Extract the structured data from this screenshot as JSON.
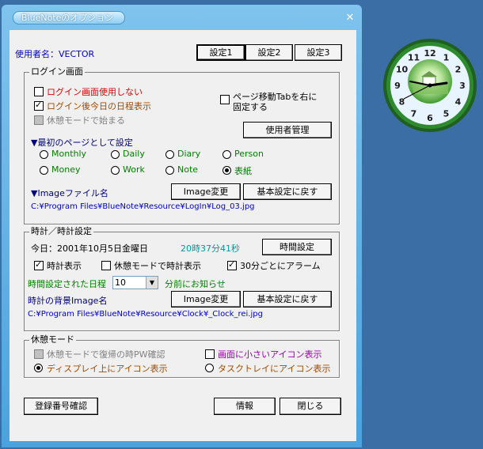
{
  "window": {
    "title": "BlueNoteのオプション",
    "close_glyph": "✕"
  },
  "user": {
    "label": "使用者名：VECTOR"
  },
  "settings_tabs": [
    "設定1",
    "設定2",
    "設定3"
  ],
  "login": {
    "group_label": "ログイン画面",
    "no_login_screen": "ログイン画面使用しない",
    "show_schedule": "ログイン後今日の日程表示",
    "start_rest_mode": "休憩モードで始まる",
    "page_tab_right": "ページ移動Tabを右に",
    "page_tab_right_2": "固定する",
    "user_manage": "使用者管理",
    "first_page_heading": "▼最初のページとして設定",
    "pages": [
      "Monthly",
      "Daily",
      "Diary",
      "Person",
      "Money",
      "Work",
      "Note",
      "表紙"
    ],
    "image_heading": "▼Imageファイル名",
    "image_change": "Image変更",
    "restore_default": "基本設定に戻す",
    "image_path": "C:¥Program Files¥BlueNote¥Resource¥LogIn¥Log_03.jpg"
  },
  "clock": {
    "group_label": "時計／時計設定",
    "today": "今日：2001年10月5日金曜日",
    "time": "20時37分41秒",
    "time_setting": "時間設定",
    "show_clock": "時計表示",
    "rest_clock": "休憩モードで時計表示",
    "alarm_30": "30分ごとにアラーム",
    "schedule_label": "時間設定された日程",
    "minutes_value": "10",
    "minutes_after": "分前にお知らせ",
    "bg_label": "時計の背景Image名",
    "image_change": "Image変更",
    "restore_default": "基本設定に戻す",
    "image_path": "C:¥Program Files¥BlueNote¥Resource¥Clock¥_Clock_rei.jpg"
  },
  "rest": {
    "group_label": "休憩モード",
    "pw_confirm": "休憩モードで復帰の時PW確認",
    "small_icon": "画面に小さいアイコン表示",
    "display_icon": "ディスプレイ上にアイコン表示",
    "tray_icon": "タスクトレイにアイコン表示"
  },
  "footer": {
    "register": "登録番号確認",
    "info": "情報",
    "close": "閉じる"
  },
  "clock_widget": {
    "numerals": [
      "12",
      "1",
      "2",
      "3",
      "4",
      "5",
      "6",
      "7",
      "8",
      "9",
      "10",
      "11"
    ]
  },
  "colors": {
    "desktop": "#3a6ea5",
    "title_gradient_top": "#7fc3ee",
    "clock_rim": "#2a7a2a"
  }
}
